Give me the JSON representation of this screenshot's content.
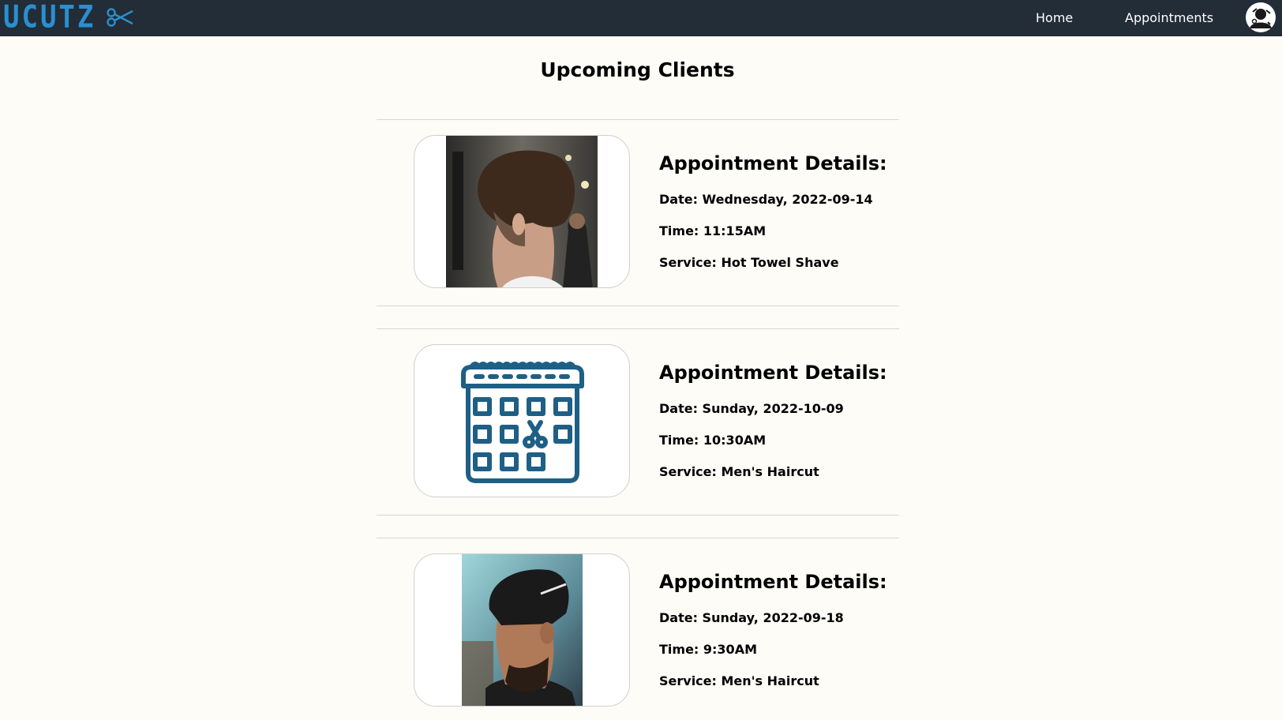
{
  "nav": {
    "brand": "UCUTZ",
    "links": [
      "Home",
      "Appointments"
    ],
    "logo_icon": "scissors-icon",
    "avatar_icon": "user-avatar-icon",
    "background": "#222d37",
    "brand_color": "#2a8fd1"
  },
  "page": {
    "title": "Upcoming Clients"
  },
  "appointments": [
    {
      "heading": "Appointment Details:",
      "date": "Date: Wednesday, 2022-09-14",
      "time": "Time: 11:15AM",
      "service": "Service: Hot Towel Shave",
      "image": "haircut-photo-back"
    },
    {
      "heading": "Appointment Details:",
      "date": "Date: Sunday, 2022-10-09",
      "time": "Time: 10:30AM",
      "service": "Service: Men's Haircut",
      "image": "calendar-scissors-icon"
    },
    {
      "heading": "Appointment Details:",
      "date": "Date: Sunday, 2022-09-18",
      "time": "Time: 9:30AM",
      "service": "Service: Men's Haircut",
      "image": "haircut-photo-side"
    }
  ],
  "colors": {
    "icon_blue": "#1e5f86",
    "page_background": "#fdfcf6"
  }
}
